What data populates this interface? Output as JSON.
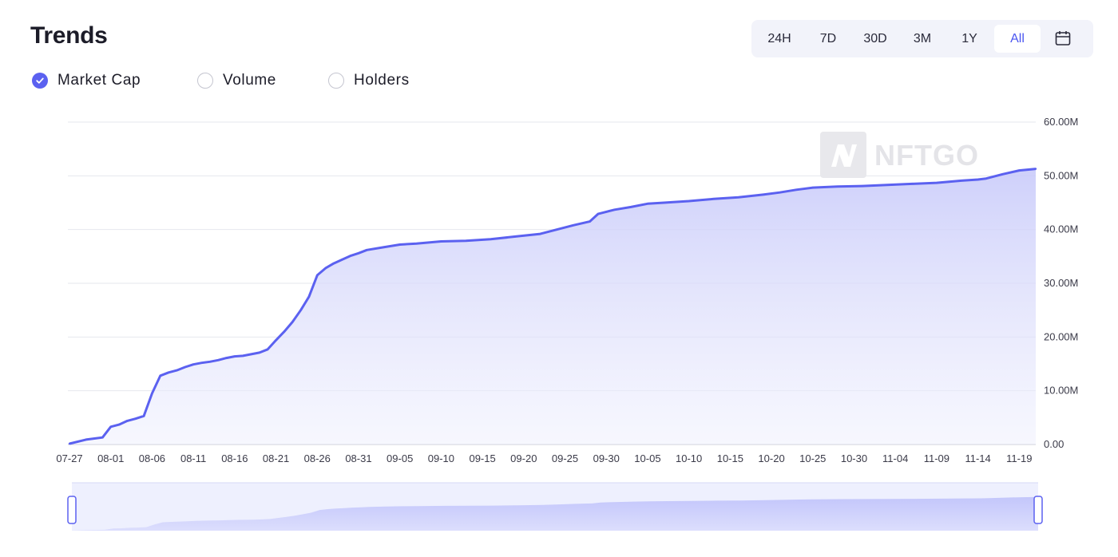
{
  "header": {
    "title": "Trends"
  },
  "range_selector": {
    "options": [
      "24H",
      "7D",
      "30D",
      "3M",
      "1Y",
      "All"
    ],
    "selected": "All",
    "calendar_icon": "calendar-icon"
  },
  "metrics": [
    {
      "label": "Market Cap",
      "checked": true
    },
    {
      "label": "Volume",
      "checked": false
    },
    {
      "label": "Holders",
      "checked": false
    }
  ],
  "watermark": {
    "text": "NFTGO",
    "icon": "nftgo-logo-icon"
  },
  "colors": {
    "line": "#5b61f0",
    "accent": "#4a55f0",
    "grid": "#e6e7ee"
  },
  "chart_data": {
    "type": "area",
    "title": "",
    "xlabel": "",
    "ylabel": "",
    "grid": true,
    "ylim": [
      0,
      60000000
    ],
    "y_ticks": [
      "0.00",
      "10.00M",
      "20.00M",
      "30.00M",
      "40.00M",
      "50.00M",
      "60.00M"
    ],
    "x_ticks": [
      "07-27",
      "08-01",
      "08-06",
      "08-11",
      "08-16",
      "08-21",
      "08-26",
      "08-31",
      "09-05",
      "09-10",
      "09-15",
      "09-20",
      "09-25",
      "09-30",
      "10-05",
      "10-10",
      "10-15",
      "10-20",
      "10-25",
      "10-30",
      "11-04",
      "11-09",
      "11-14",
      "11-19"
    ],
    "series": [
      {
        "x": [
          "07-27",
          "07-29",
          "07-31",
          "08-01",
          "08-02",
          "08-03",
          "08-04",
          "08-05",
          "08-06",
          "08-07",
          "08-08",
          "08-09",
          "08-10",
          "08-11",
          "08-12",
          "08-13",
          "08-14",
          "08-15",
          "08-16",
          "08-17",
          "08-18",
          "08-19",
          "08-20",
          "08-21",
          "08-22",
          "08-23",
          "08-24",
          "08-25",
          "08-26",
          "08-27",
          "08-28",
          "08-29",
          "08-30",
          "08-31",
          "09-01",
          "09-03",
          "09-05",
          "09-07",
          "09-10",
          "09-13",
          "09-16",
          "09-19",
          "09-22",
          "09-24",
          "09-26",
          "09-28",
          "09-29",
          "09-30",
          "10-01",
          "10-03",
          "10-05",
          "10-07",
          "10-10",
          "10-13",
          "10-16",
          "10-19",
          "10-21",
          "10-23",
          "10-25",
          "10-28",
          "10-31",
          "11-03",
          "11-06",
          "11-09",
          "11-12",
          "11-14",
          "11-15",
          "11-17",
          "11-19",
          "11-21"
        ],
        "values": [
          150000,
          900000,
          1300000,
          3300000,
          3700000,
          4400000,
          4800000,
          5300000,
          9500000,
          12800000,
          13400000,
          13800000,
          14400000,
          14900000,
          15200000,
          15400000,
          15700000,
          16100000,
          16400000,
          16500000,
          16800000,
          17100000,
          17700000,
          19400000,
          21000000,
          22800000,
          25000000,
          27500000,
          31500000,
          32800000,
          33700000,
          34400000,
          35100000,
          35600000,
          36200000,
          36700000,
          37200000,
          37400000,
          37800000,
          37900000,
          38200000,
          38700000,
          39200000,
          40000000,
          40800000,
          41500000,
          42900000,
          43300000,
          43700000,
          44200000,
          44800000,
          45000000,
          45300000,
          45700000,
          46000000,
          46500000,
          46900000,
          47400000,
          47800000,
          48000000,
          48100000,
          48300000,
          48500000,
          48700000,
          49100000,
          49300000,
          49500000,
          50300000,
          51000000,
          51300000
        ]
      }
    ]
  }
}
